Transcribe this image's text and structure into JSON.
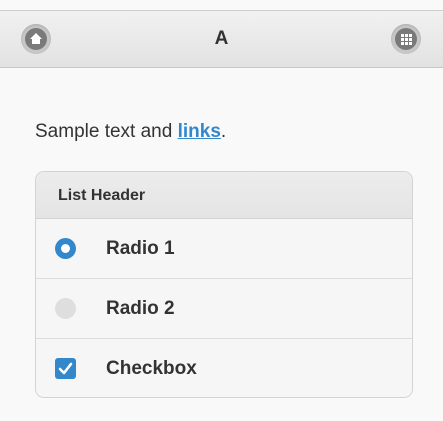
{
  "header": {
    "title": "A",
    "left_icon": "home-icon",
    "right_icon": "grid-icon"
  },
  "content": {
    "text_prefix": "Sample text and ",
    "link_text": "links",
    "text_suffix": "."
  },
  "list": {
    "header": "List Header",
    "items": [
      {
        "label": "Radio 1",
        "type": "radio",
        "checked": true
      },
      {
        "label": "Radio 2",
        "type": "radio",
        "checked": false
      },
      {
        "label": "Checkbox",
        "type": "checkbox",
        "checked": true
      }
    ]
  },
  "colors": {
    "accent": "#3388cc",
    "header_bg": "#e9e9e9",
    "text": "#333333"
  }
}
